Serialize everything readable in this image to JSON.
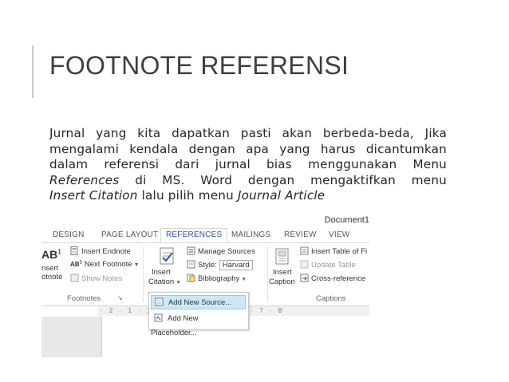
{
  "slide": {
    "title": "FOOTNOTE REFERENSI",
    "body": {
      "line1": "Jurnal yang kita dapatkan pasti akan berbeda-beda, Jika",
      "line2": "mengalami kendala dengan apa yang harus dicantumkan",
      "line3": "dalam referensi dari jurnal bias menggunakan Menu",
      "line4_italic": "References",
      "line4_rest": " di MS. Word dengan mengaktifkan menu",
      "line5_italic1": "Insert Citation",
      "line5_mid": " lalu pilih menu ",
      "line5_italic2": "Journal Article"
    }
  },
  "word": {
    "doc_title": "Document1",
    "tabs": [
      "DESIGN",
      "PAGE LAYOUT",
      "REFERENCES",
      "MAILINGS",
      "REVIEW",
      "VIEW"
    ],
    "footnotes": {
      "insert_endnote": "Insert Endnote",
      "next_footnote": "Next Footnote",
      "show_notes": "Show Notes",
      "big_label_1": "nsert",
      "big_label_2": "otnote",
      "group": "Footnotes"
    },
    "citations": {
      "insert_citation_1": "Insert",
      "insert_citation_2": "Citation",
      "manage_sources": "Manage Sources",
      "style_label": "Style:",
      "style_value": "Harvard",
      "bibliography": "Bibliography"
    },
    "captions": {
      "insert_caption_1": "Insert",
      "insert_caption_2": "Caption",
      "insert_table_of_figures": "Insert Table of Fi",
      "update_table": "Update Table",
      "cross_reference": "Cross-reference",
      "group": "Captions"
    },
    "menu": {
      "add_new_source": "Add New Source...",
      "add_new_placeholder": "Add New Placeholder..."
    },
    "ruler": "· 2 · 1 · 1 · 2 · 3 · 4 · 5 · 6 · 7 · 8"
  },
  "colors": {
    "accent_tab": "#2b579a",
    "menu_highlight": "#cde8f5"
  }
}
